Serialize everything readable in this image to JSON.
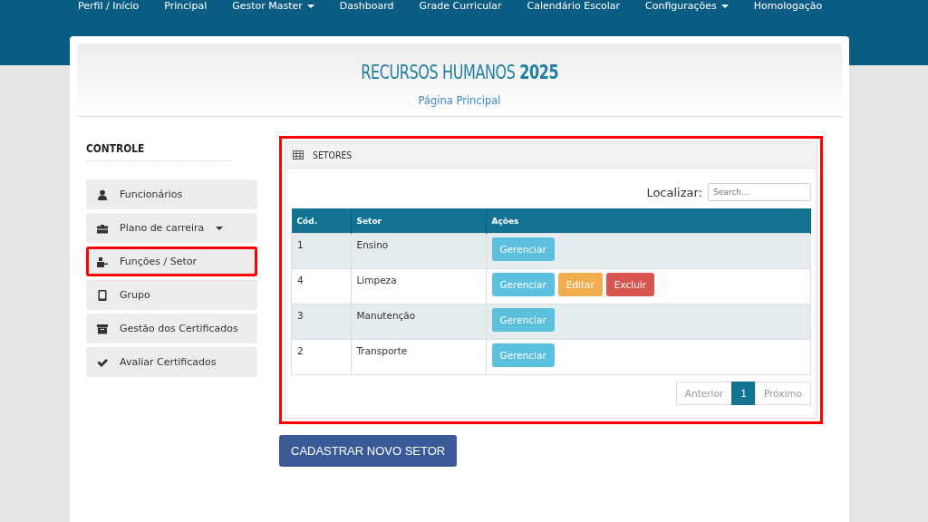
{
  "nav": [
    {
      "label": "Perfil / Início",
      "dropdown": false
    },
    {
      "label": "Principal",
      "dropdown": false
    },
    {
      "label": "Gestor Master",
      "dropdown": true
    },
    {
      "label": "Dashboard",
      "dropdown": false
    },
    {
      "label": "Grade Curricular",
      "dropdown": false
    },
    {
      "label": "Calendário Escolar",
      "dropdown": false
    },
    {
      "label": "Configurações",
      "dropdown": true
    },
    {
      "label": "Homologação",
      "dropdown": false
    }
  ],
  "header": {
    "title": "RECURSOS HUMANOS **2025**",
    "subtitle": "Página Principal"
  },
  "sidebar": {
    "title": "CONTROLE",
    "items": [
      {
        "label": "Funcionários",
        "kind": "user",
        "dropdown": false,
        "highlighted": false
      },
      {
        "label": "Plano de carreira",
        "kind": "briefcase",
        "dropdown": true,
        "highlighted": false
      },
      {
        "label": "Funções / Setor",
        "kind": "sitemap",
        "dropdown": false,
        "highlighted": true
      },
      {
        "label": "Grupo",
        "kind": "tablet",
        "dropdown": false,
        "highlighted": false
      },
      {
        "label": "Gestão dos Certificados",
        "kind": "archive",
        "dropdown": false,
        "highlighted": false
      },
      {
        "label": "Avaliar Certificados",
        "kind": "check",
        "dropdown": false,
        "highlighted": false
      }
    ]
  },
  "panel": {
    "title": "SETORES",
    "highlighted": true,
    "search": {
      "label": "Localizar:",
      "placeholder": "Search..."
    },
    "table": {
      "columns": [
        "Cód.",
        "Setor",
        "Ações"
      ],
      "rows": [
        {
          "code": "1",
          "name": "Ensino",
          "actions": [
            {
              "label": "Gerenciar",
              "kind": "info"
            }
          ]
        },
        {
          "code": "4",
          "name": "Limpeza",
          "actions": [
            {
              "label": "Gerenciar",
              "kind": "info"
            },
            {
              "label": "Editar",
              "kind": "warning"
            },
            {
              "label": "Excluir",
              "kind": "danger"
            }
          ]
        },
        {
          "code": "3",
          "name": "Manutenção",
          "actions": [
            {
              "label": "Gerenciar",
              "kind": "info"
            }
          ]
        },
        {
          "code": "2",
          "name": "Transporte",
          "actions": [
            {
              "label": "Gerenciar",
              "kind": "info"
            }
          ]
        }
      ]
    },
    "pagination": [
      {
        "label": "Anterior",
        "selected": false
      },
      {
        "label": "1",
        "selected": true
      },
      {
        "label": "Próximo",
        "selected": false
      }
    ]
  },
  "add_button": "CADASTRAR NOVO SETOR"
}
